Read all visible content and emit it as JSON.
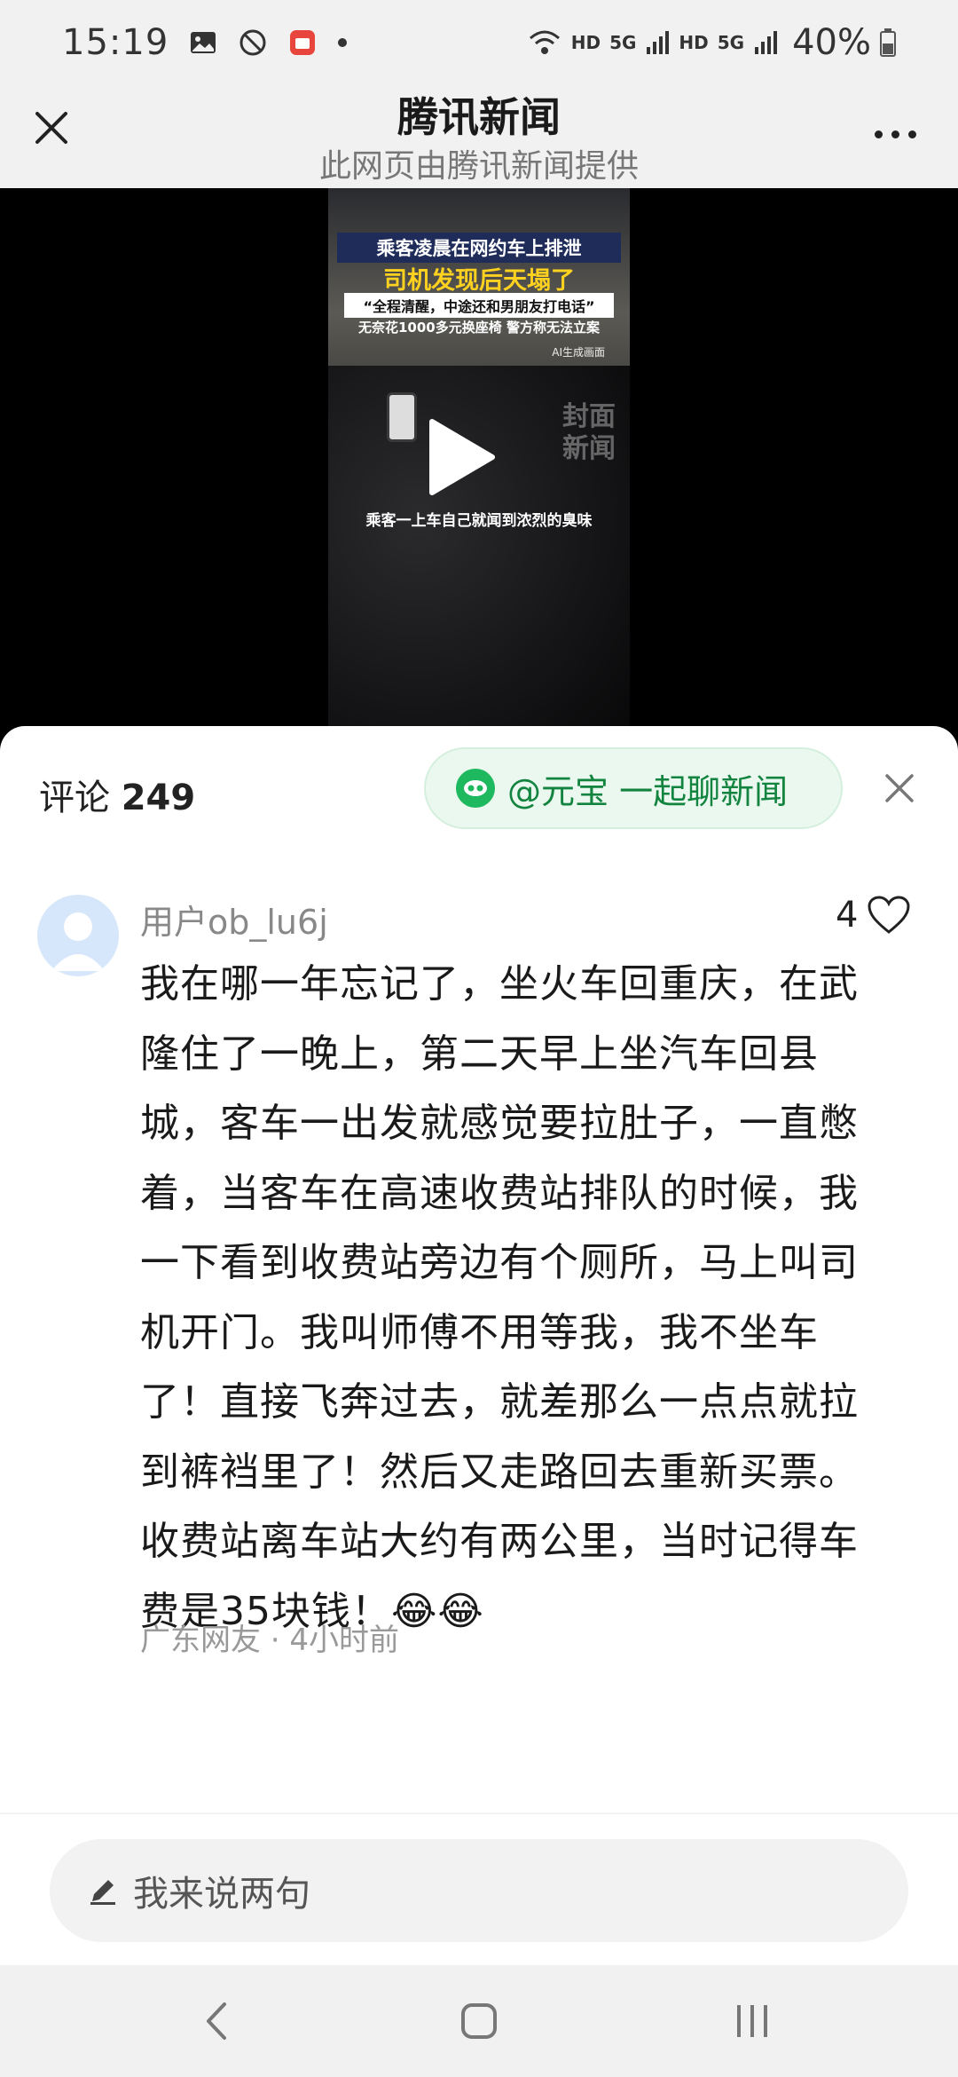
{
  "status_bar": {
    "time": "15:19",
    "hd1": "HD",
    "net1": "5G",
    "hd2": "HD",
    "net2": "5G",
    "battery": "40%",
    "icons": [
      "image-icon",
      "do-not-disturb-icon",
      "app-notification-icon",
      "dot-icon",
      "wifi-icon",
      "signal-icon",
      "battery-icon"
    ]
  },
  "header": {
    "title": "腾讯新闻",
    "subtitle": "此网页由腾讯新闻提供"
  },
  "video": {
    "headline1": "乘客凌晨在网约车上排泄",
    "headline2": "司机发现后天塌了",
    "quote": "“全程清醒，中途还和男朋友打电话”",
    "line3": "无奈花1000多元换座椅 警方称无法立案",
    "ai_note": "AI生成画面",
    "watermark": "封面新闻",
    "caption": "乘客一上车自己就闻到浓烈的臭味"
  },
  "comments": {
    "label": "评论",
    "count": "249",
    "yuanbao_label": "@元宝 一起聊新闻"
  },
  "comment": {
    "username": "用户ob_lu6j",
    "likes": "4",
    "text": "我在哪一年忘记了，坐火车回重庆，在武隆住了一晚上，第二天早上坐汽车回县城，客车一出发就感觉要拉肚子，一直憋着，当客车在高速收费站排队的时候，我一下看到收费站旁边有个厕所，马上叫司机开门。我叫师傅不用等我，我不坐车了！直接飞奔过去，就差那么一点点就拉到裤裆里了！然后又走路回去重新买票。收费站离车站大约有两公里，当时记得车费是35块钱！😂😂",
    "meta": "广东网友 · 4小时前"
  },
  "input": {
    "placeholder": "我来说两句"
  },
  "colors": {
    "accent_green": "#1eb85f",
    "pill_bg": "#eaf8ef",
    "headline_yellow": "#ffd21f"
  }
}
